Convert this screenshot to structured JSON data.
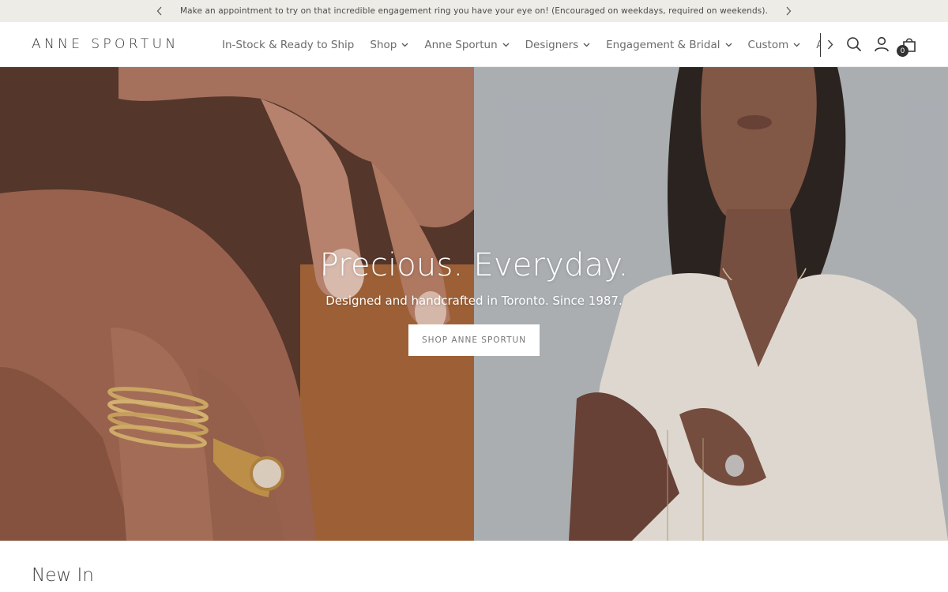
{
  "announcement": {
    "text": "Make an appointment to try on that incredible engagement ring you have your eye on! (Encouraged on weekdays, required on weekends).",
    "prev_icon": "chevron-left-icon",
    "next_icon": "chevron-right-icon"
  },
  "header": {
    "logo": "ANNE SPORTUN",
    "nav": [
      {
        "label": "In-Stock & Ready to Ship",
        "has_dropdown": false
      },
      {
        "label": "Shop",
        "has_dropdown": true
      },
      {
        "label": "Anne Sportun",
        "has_dropdown": true
      },
      {
        "label": "Designers",
        "has_dropdown": true
      },
      {
        "label": "Engagement & Bridal",
        "has_dropdown": true
      },
      {
        "label": "Custom",
        "has_dropdown": true
      },
      {
        "label": "A",
        "has_dropdown": false
      }
    ],
    "icons": [
      "search-icon",
      "account-icon",
      "cart-icon"
    ],
    "cart_count": "0"
  },
  "hero": {
    "title": "Precious. Everyday.",
    "subtitle": "Designed and handcrafted in Toronto. Since 1987.",
    "button": "SHOP ANNE SPORTUN"
  },
  "sections": {
    "new_in_title": "New In"
  },
  "colors": {
    "announcement_bg": "#edece7",
    "text": "#333333",
    "button_bg": "#ffffff"
  }
}
